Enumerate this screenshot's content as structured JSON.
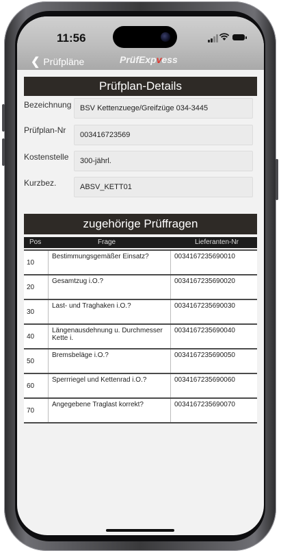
{
  "status": {
    "time": "11:56"
  },
  "nav": {
    "back_label": "Prüfpläne",
    "brand_prefix": "PrüfExp",
    "brand_accent": "v",
    "brand_suffix": "ess",
    "accent_color": "#e2342c"
  },
  "details": {
    "title": "Prüfplan-Details",
    "fields": [
      {
        "label": "Bezeichnung",
        "value": "BSV Kettenzuege/Greifzüge 034-3445"
      },
      {
        "label": "Prüfplan-Nr",
        "value": "003416723569"
      },
      {
        "label": "Kostenstelle",
        "value": "300-jährl."
      },
      {
        "label": "Kurzbez.",
        "value": "ABSV_KETT01"
      }
    ]
  },
  "questions": {
    "title": "zugehörige Prüffragen",
    "columns": {
      "pos": "Pos",
      "frage": "Frage",
      "lief": "Lieferanten-Nr"
    },
    "rows": [
      {
        "pos": "10",
        "frage": "Bestimmungsgemäßer Einsatz?",
        "lief": "0034167235690010"
      },
      {
        "pos": "20",
        "frage": "Gesamtzug i.O.?",
        "lief": "0034167235690020"
      },
      {
        "pos": "30",
        "frage": "Last- und Traghaken i.O.?",
        "lief": "0034167235690030"
      },
      {
        "pos": "40",
        "frage": "Längenausdehnung u. Durchmesser Kette i.",
        "lief": "0034167235690040"
      },
      {
        "pos": "50",
        "frage": "Bremsbeläge i.O.?",
        "lief": "0034167235690050"
      },
      {
        "pos": "60",
        "frage": "Sperrriegel und Kettenrad i.O.?",
        "lief": "0034167235690060"
      },
      {
        "pos": "70",
        "frage": "Angegebene Traglast korrekt?",
        "lief": "0034167235690070"
      }
    ]
  }
}
